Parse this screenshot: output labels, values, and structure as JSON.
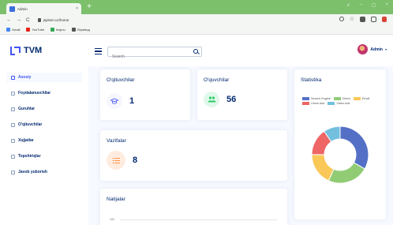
{
  "browser": {
    "tab_title": "Admin",
    "tab_close": "×",
    "new_tab": "+",
    "window_controls": [
      "∨",
      "–",
      "▢",
      "×"
    ],
    "url": "jspitvm.uz/home",
    "nav": [
      "←",
      "→",
      "C"
    ],
    "bookmarks": [
      {
        "label": "Gmail",
        "color": "#4285f4"
      },
      {
        "label": "YouTube",
        "color": "#e62117"
      },
      {
        "label": "Карты",
        "color": "#34a853"
      },
      {
        "label": "Перевод",
        "color": "#555555"
      }
    ]
  },
  "header": {
    "brand": "TVM",
    "search_placeholder": "Search",
    "admin_name": "Admin",
    "admin_caret": "▾"
  },
  "sidebar": {
    "items": [
      {
        "label": "Asosiy",
        "active": true
      },
      {
        "label": "Foydalanuvchilar",
        "active": false
      },
      {
        "label": "Guruhlar",
        "active": false
      },
      {
        "label": "O'qituvchilar",
        "active": false
      },
      {
        "label": "Xujjatlar",
        "active": false
      },
      {
        "label": "Topshiriqlar",
        "active": false
      },
      {
        "label": "Javob yuborish",
        "active": false
      }
    ]
  },
  "cards": {
    "teachers": {
      "title": "O'qituvchilar",
      "value": "1",
      "icon": "graduation-icon",
      "icon_color": "#4154f1",
      "icon_bg": "#f6f6fe"
    },
    "students": {
      "title": "O'quvchilar",
      "value": "56",
      "icon": "users-icon",
      "icon_color": "#2eca6a",
      "icon_bg": "#e0f8e9"
    },
    "tasks": {
      "title": "Vazifalar",
      "value": "8",
      "icon": "list-icon",
      "icon_color": "#ff771d",
      "icon_bg": "#ffecdf"
    },
    "results": {
      "title": "Natijalar",
      "axis_tick": "100"
    }
  },
  "stats": {
    "title": "Statistika",
    "chart_data": {
      "type": "pie",
      "categories": [
        "Search Engine",
        "Direct",
        "Email",
        "Union Ads",
        "Video Ads"
      ],
      "values": [
        1048,
        735,
        580,
        484,
        300
      ],
      "colors": [
        "#5470c6",
        "#91cc75",
        "#fac858",
        "#ee6666",
        "#73c0de"
      ],
      "legend_position": "top"
    }
  }
}
